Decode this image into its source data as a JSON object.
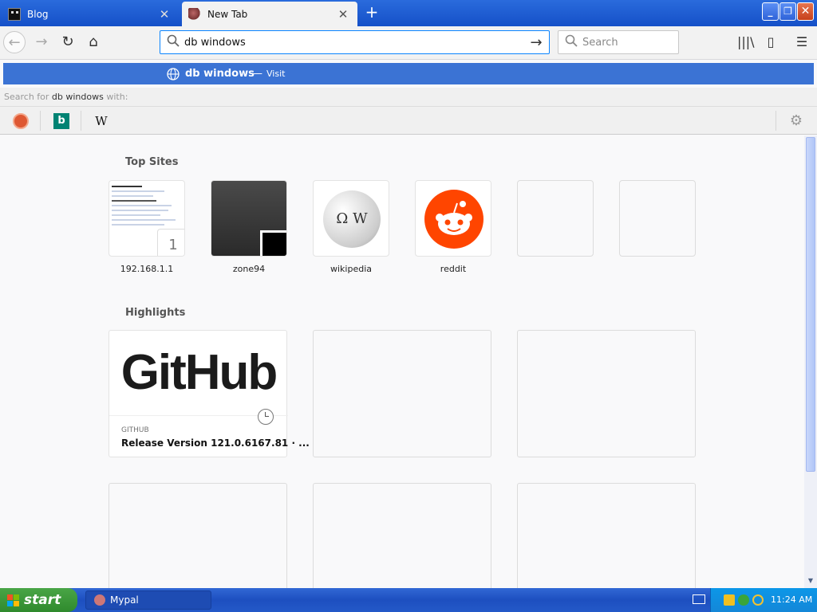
{
  "tabs": [
    {
      "title": "Blog",
      "close": "✕"
    },
    {
      "title": "New Tab",
      "close": "✕"
    }
  ],
  "new_tab_symbol": "+",
  "window_controls": {
    "minimize": "_",
    "maximize": "❐",
    "close": "✕"
  },
  "nav": {
    "back": "←",
    "forward": "→",
    "reload": "↻",
    "home": "⌂"
  },
  "urlbar": {
    "value": "db windows",
    "go": "→"
  },
  "searchbar": {
    "placeholder": "Search"
  },
  "toolbar_icons": {
    "library": "|||\\",
    "sidebar": "▯",
    "menu": "☰"
  },
  "autocomplete": {
    "title": "db windows",
    "dash": "—",
    "action": "Visit"
  },
  "search_with": {
    "prefix": "Search for",
    "query": "db windows",
    "suffix": "with:"
  },
  "engines": {
    "bing": "b",
    "wikipedia": "W"
  },
  "newtab": {
    "top_sites_title": "Top Sites",
    "top_sites": [
      {
        "label": "192.168.1.1",
        "badge": "1"
      },
      {
        "label": "zone94"
      },
      {
        "label": "wikipedia",
        "glyph": "Ω W"
      },
      {
        "label": "reddit"
      },
      {
        "label": ""
      },
      {
        "label": ""
      }
    ],
    "highlights_title": "Highlights",
    "highlights": [
      {
        "logo": "GitHub",
        "source": "GITHUB",
        "title": "Release Version 121.0.6167.81 · ..."
      }
    ]
  },
  "taskbar": {
    "start": "start",
    "app": "Mypal",
    "clock": "11:24 AM"
  },
  "colors": {
    "xp_blue": "#2a6bdc",
    "autocomplete_highlight": "#3b73d4",
    "reddit": "#ff4500",
    "start_green": "#3c9a3a"
  }
}
